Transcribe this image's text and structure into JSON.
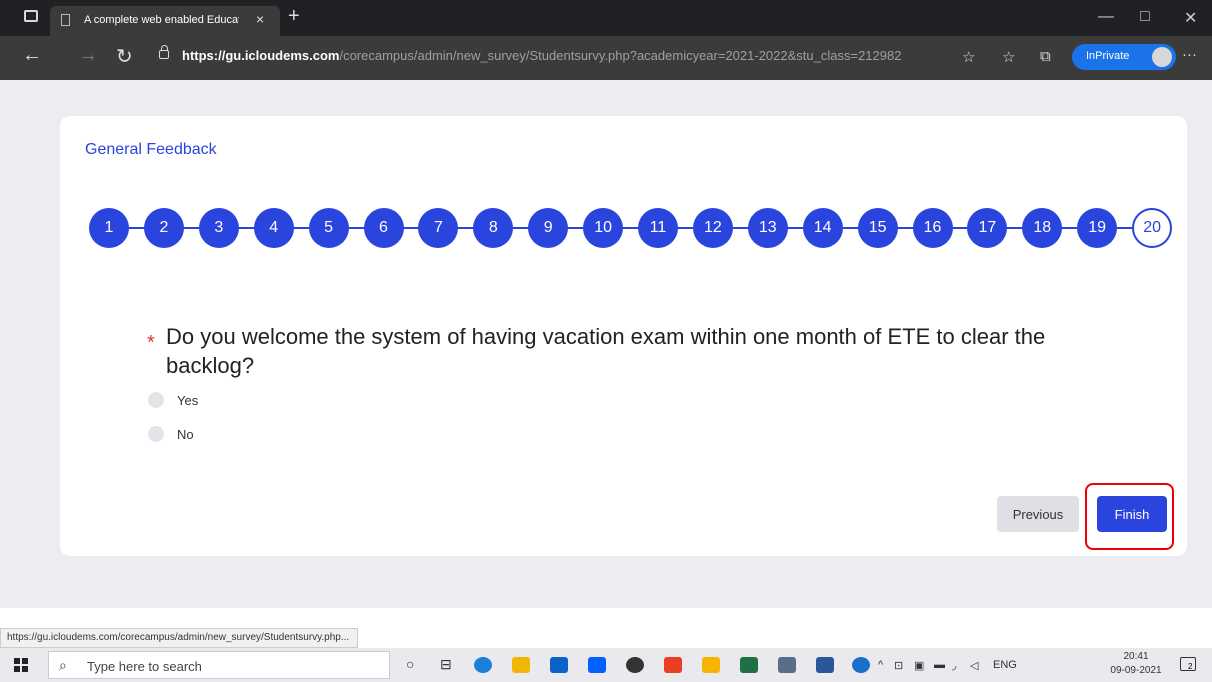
{
  "browser": {
    "tab_title": "A complete web enabled Educati",
    "tab_close": "×",
    "new_tab": "+",
    "url_host": "https://gu.icloudems.com",
    "url_path": "/corecampus/admin/new_survey/Studentsurvy.php?academicyear=2021-2022&stu_class=212982",
    "inprivate_label": "InPrivate",
    "minimize": "—",
    "maximize": "□",
    "close": "✕",
    "more": "···"
  },
  "survey": {
    "title": "General Feedback",
    "steps": [
      "1",
      "2",
      "3",
      "4",
      "5",
      "6",
      "7",
      "8",
      "9",
      "10",
      "11",
      "12",
      "13",
      "14",
      "15",
      "16",
      "17",
      "18",
      "19",
      "20"
    ],
    "current_step": "20",
    "required_mark": "*",
    "question": "Do you welcome the system of having vacation exam within one month of ETE to clear the backlog?",
    "options": [
      "Yes",
      "No"
    ],
    "previous_label": "Previous",
    "finish_label": "Finish"
  },
  "status_bar": {
    "url": "https://gu.icloudems.com/corecampus/admin/new_survey/Studentsurvy.php..."
  },
  "taskbar": {
    "search_placeholder": "Type here to search",
    "language": "ENG",
    "time": "20:41",
    "date": "09-09-2021",
    "notification_count": "2"
  },
  "colors": {
    "accent": "#2a44de",
    "highlight": "#e00000",
    "page_background": "#ececf3"
  }
}
